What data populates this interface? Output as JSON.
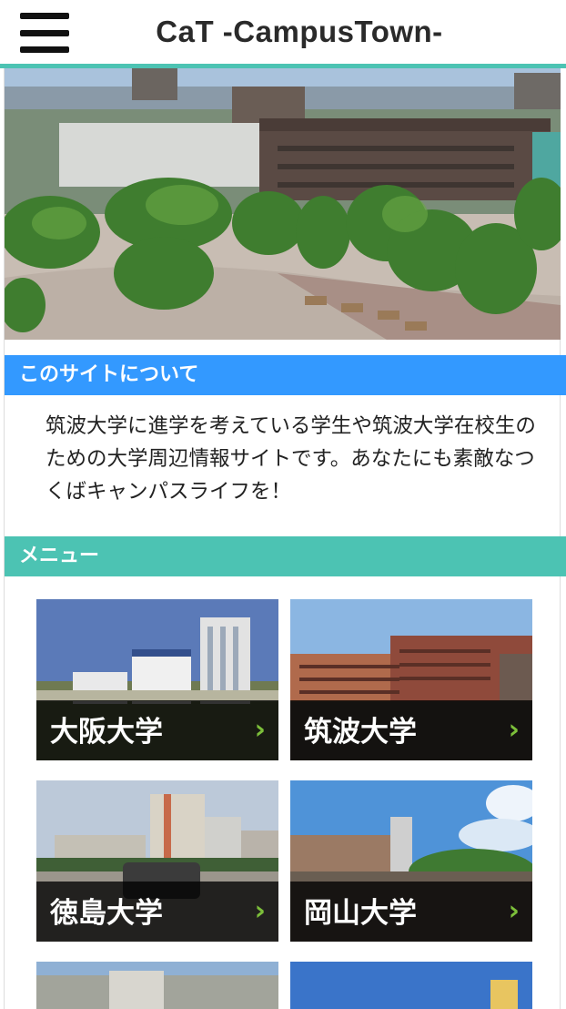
{
  "header": {
    "title": "CaT -CampusTown-",
    "menu_icon": "hamburger-menu-icon",
    "accent_color": "#4cc3b3"
  },
  "hero": {
    "image": "campus-photo"
  },
  "about": {
    "heading": "このサイトについて",
    "heading_color": "#3399ff",
    "text": "筑波大学に進学を考えている学生や筑波大学在校生のための大学周辺情報サイトです。あなたにも素敵なつくばキャンパスライフを！"
  },
  "menu": {
    "heading": "メニュー",
    "heading_color": "#4cc3b3",
    "items": [
      {
        "label": "大阪大学",
        "icon": "chevron-right-icon"
      },
      {
        "label": "筑波大学",
        "icon": "chevron-right-icon"
      },
      {
        "label": "徳島大学",
        "icon": "chevron-right-icon"
      },
      {
        "label": "岡山大学",
        "icon": "chevron-right-icon"
      }
    ],
    "chevron_glyph": "›",
    "chevron_color": "#7cbf3a"
  }
}
